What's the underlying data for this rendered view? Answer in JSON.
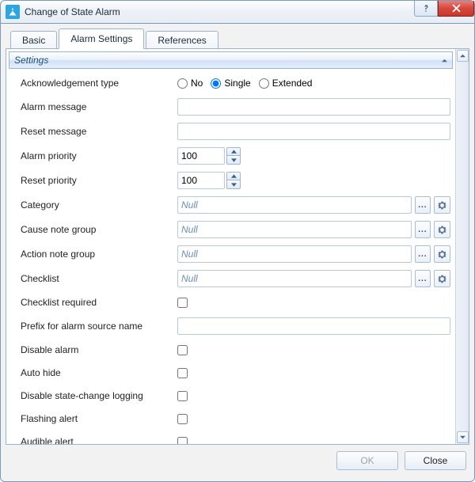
{
  "window": {
    "title": "Change of State Alarm"
  },
  "tabs": {
    "basic": "Basic",
    "alarm": "Alarm Settings",
    "references": "References",
    "active": "alarm"
  },
  "section": {
    "title": "Settings"
  },
  "labels": {
    "ack_type": "Acknowledgement type",
    "alarm_message": "Alarm message",
    "reset_message": "Reset message",
    "alarm_priority": "Alarm priority",
    "reset_priority": "Reset priority",
    "category": "Category",
    "cause_note_group": "Cause note group",
    "action_note_group": "Action note group",
    "checklist": "Checklist",
    "checklist_required": "Checklist required",
    "prefix_alarm_source": "Prefix for alarm source name",
    "disable_alarm": "Disable alarm",
    "auto_hide": "Auto hide",
    "disable_state_change_logging": "Disable state-change logging",
    "flashing_alert": "Flashing alert",
    "audible_alert": "Audible alert"
  },
  "ack": {
    "no": "No",
    "single": "Single",
    "extended": "Extended",
    "selected": "single"
  },
  "values": {
    "alarm_message": "",
    "reset_message": "",
    "alarm_priority": "100",
    "reset_priority": "100",
    "category": "Null",
    "cause_note_group": "Null",
    "action_note_group": "Null",
    "checklist": "Null",
    "checklist_required": false,
    "prefix_alarm_source": "",
    "disable_alarm": false,
    "auto_hide": false,
    "disable_state_change_logging": false,
    "flashing_alert": false,
    "audible_alert": false
  },
  "buttons": {
    "browse": "...",
    "ok": "OK",
    "close": "Close"
  }
}
